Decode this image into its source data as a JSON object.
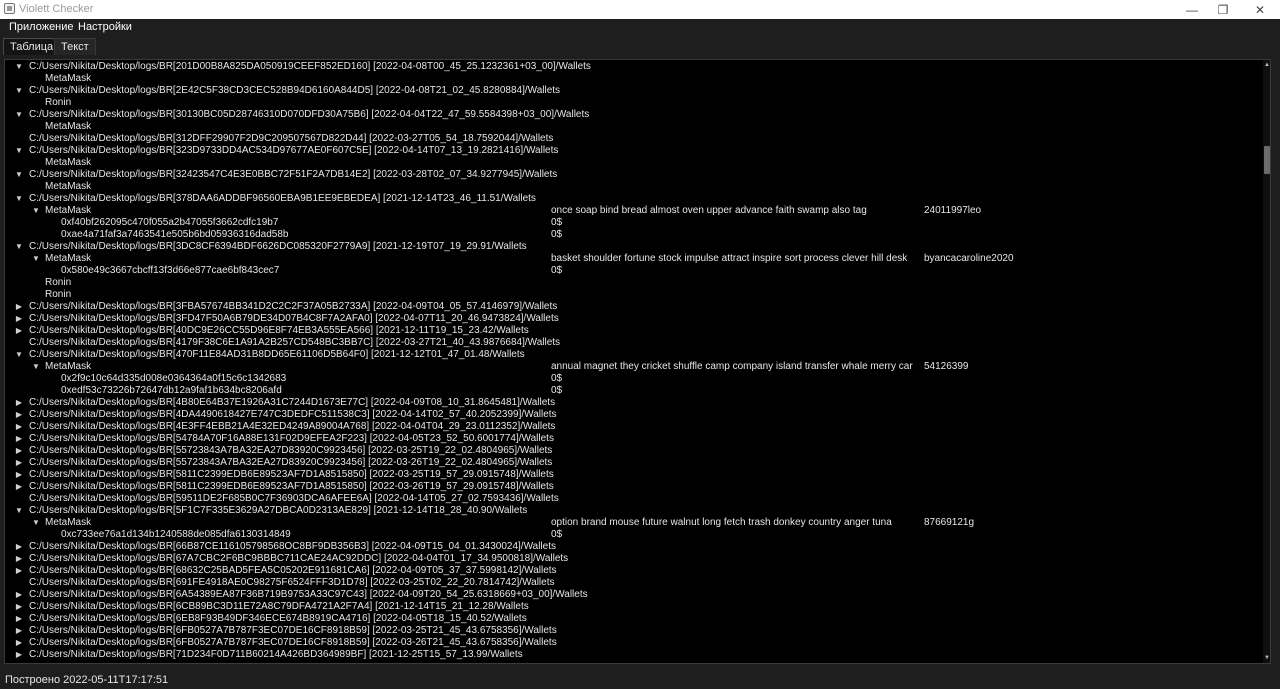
{
  "window": {
    "title": "Violett Checker",
    "min_glyph": "—",
    "restore_glyph": "❐",
    "close_glyph": "✕"
  },
  "menu": {
    "items": [
      "Приложение",
      "Настройки"
    ]
  },
  "tabs": [
    {
      "label": "Таблица",
      "active": true
    },
    {
      "label": "Текст",
      "active": false
    }
  ],
  "status": "Построено 2022-05-11T17:17:51",
  "tree": [
    {
      "level": 0,
      "toggle": "expanded",
      "cols": [
        "C:/Users/Nikita/Desktop/logs/BR[201D00B8A825DA050919CEEF852ED160] [2022-04-08T00_45_25.1232361+03_00]/Wallets"
      ]
    },
    {
      "level": 1,
      "toggle": "none",
      "cols": [
        "MetaMask"
      ]
    },
    {
      "level": 0,
      "toggle": "expanded",
      "cols": [
        "C:/Users/Nikita/Desktop/logs/BR[2E42C5F38CD3CEC528B94D6160A844D5] [2022-04-08T21_02_45.8280884]/Wallets"
      ]
    },
    {
      "level": 1,
      "toggle": "none",
      "cols": [
        "Ronin"
      ]
    },
    {
      "level": 0,
      "toggle": "expanded",
      "cols": [
        "C:/Users/Nikita/Desktop/logs/BR[30130BC05D28746310D070DFD30A75B6] [2022-04-04T22_47_59.5584398+03_00]/Wallets"
      ]
    },
    {
      "level": 1,
      "toggle": "none",
      "cols": [
        "MetaMask"
      ]
    },
    {
      "level": 0,
      "toggle": "none",
      "cols": [
        "C:/Users/Nikita/Desktop/logs/BR[312DFF29907F2D9C209507567D822D44] [2022-03-27T05_54_18.7592044]/Wallets"
      ]
    },
    {
      "level": 0,
      "toggle": "expanded",
      "cols": [
        "C:/Users/Nikita/Desktop/logs/BR[323D9733DD4AC534D97677AE0F607C5E] [2022-04-14T07_13_19.2821416]/Wallets"
      ]
    },
    {
      "level": 1,
      "toggle": "none",
      "cols": [
        "MetaMask"
      ]
    },
    {
      "level": 0,
      "toggle": "expanded",
      "cols": [
        "C:/Users/Nikita/Desktop/logs/BR[32423547C4E3E0BBC72F51F2A7DB14E2] [2022-03-28T02_07_34.9277945]/Wallets"
      ]
    },
    {
      "level": 1,
      "toggle": "none",
      "cols": [
        "MetaMask"
      ]
    },
    {
      "level": 0,
      "toggle": "expanded",
      "cols": [
        "C:/Users/Nikita/Desktop/logs/BR[378DAA6ADDBF96560EBA9B1EE9EBEDEA] [2021-12-14T23_46_11.51/Wallets"
      ]
    },
    {
      "level": 1,
      "toggle": "expanded",
      "cols": [
        "MetaMask",
        "once soap bind bread almost oven upper advance faith swamp also tag",
        "24011997leo"
      ]
    },
    {
      "level": 2,
      "toggle": "none",
      "cols": [
        "0xf40bf262095c470f055a2b47055f3662cdfc19b7",
        "0$"
      ]
    },
    {
      "level": 2,
      "toggle": "none",
      "cols": [
        "0xae4a71faf3a7463541e505b6bd05936316dad58b",
        "0$"
      ]
    },
    {
      "level": 0,
      "toggle": "expanded",
      "cols": [
        "C:/Users/Nikita/Desktop/logs/BR[3DC8CF6394BDF6626DC085320F2779A9] [2021-12-19T07_19_29.91/Wallets"
      ]
    },
    {
      "level": 1,
      "toggle": "expanded",
      "cols": [
        "MetaMask",
        "basket shoulder fortune stock impulse attract inspire sort process clever hill desk",
        "byancacaroline2020"
      ]
    },
    {
      "level": 2,
      "toggle": "none",
      "cols": [
        "0x580e49c3667cbcff13f3d66e877cae6bf843cec7",
        "0$"
      ]
    },
    {
      "level": 1,
      "toggle": "none",
      "cols": [
        "Ronin"
      ]
    },
    {
      "level": 1,
      "toggle": "none",
      "cols": [
        "Ronin"
      ]
    },
    {
      "level": 0,
      "toggle": "collapsed",
      "cols": [
        "C:/Users/Nikita/Desktop/logs/BR[3FBA57674BB341D2C2C2F37A05B2733A] [2022-04-09T04_05_57.4146979]/Wallets"
      ]
    },
    {
      "level": 0,
      "toggle": "collapsed",
      "cols": [
        "C:/Users/Nikita/Desktop/logs/BR[3FD47F50A6B79DE34D07B4C8F7A2AFA0] [2022-04-07T11_20_46.9473824]/Wallets"
      ]
    },
    {
      "level": 0,
      "toggle": "collapsed",
      "cols": [
        "C:/Users/Nikita/Desktop/logs/BR[40DC9E26CC55D96E8F74EB3A555EA566] [2021-12-11T19_15_23.42/Wallets"
      ]
    },
    {
      "level": 0,
      "toggle": "none",
      "cols": [
        "C:/Users/Nikita/Desktop/logs/BR[4179F38C6E1A91A2B257CD548BC3BB7C] [2022-03-27T21_40_43.9876684]/Wallets"
      ]
    },
    {
      "level": 0,
      "toggle": "expanded",
      "cols": [
        "C:/Users/Nikita/Desktop/logs/BR[470F11E84AD31B8DD65E61106D5B64F0] [2021-12-12T01_47_01.48/Wallets"
      ]
    },
    {
      "level": 1,
      "toggle": "expanded",
      "cols": [
        "MetaMask",
        "annual magnet they cricket shuffle camp company island transfer whale merry car",
        "54126399"
      ]
    },
    {
      "level": 2,
      "toggle": "none",
      "cols": [
        "0x2f9c10c64d335d008e0364364a0f15c6c1342683",
        "0$"
      ]
    },
    {
      "level": 2,
      "toggle": "none",
      "cols": [
        "0xedf53c73226b72647db12a9faf1b634bc8206afd",
        "0$"
      ]
    },
    {
      "level": 0,
      "toggle": "collapsed",
      "cols": [
        "C:/Users/Nikita/Desktop/logs/BR[4B80E64B37E1926A31C7244D1673E77C] [2022-04-09T08_10_31.8645481]/Wallets"
      ]
    },
    {
      "level": 0,
      "toggle": "collapsed",
      "cols": [
        "C:/Users/Nikita/Desktop/logs/BR[4DA4490618427E747C3DEDFC511538C3] [2022-04-14T02_57_40.2052399]/Wallets"
      ]
    },
    {
      "level": 0,
      "toggle": "collapsed",
      "cols": [
        "C:/Users/Nikita/Desktop/logs/BR[4E3FF4EBB21A4E32ED4249A89004A768] [2022-04-04T04_29_23.0112352]/Wallets"
      ]
    },
    {
      "level": 0,
      "toggle": "collapsed",
      "cols": [
        "C:/Users/Nikita/Desktop/logs/BR[54784A70F16A88E131F02D9EFEA2F223] [2022-04-05T23_52_50.6001774]/Wallets"
      ]
    },
    {
      "level": 0,
      "toggle": "collapsed",
      "cols": [
        "C:/Users/Nikita/Desktop/logs/BR[55723843A7BA32EA27D83920C9923456] [2022-03-25T19_22_02.4804965]/Wallets"
      ]
    },
    {
      "level": 0,
      "toggle": "collapsed",
      "cols": [
        "C:/Users/Nikita/Desktop/logs/BR[55723843A7BA32EA27D83920C9923456] [2022-03-26T19_22_02.4804965]/Wallets"
      ]
    },
    {
      "level": 0,
      "toggle": "collapsed",
      "cols": [
        "C:/Users/Nikita/Desktop/logs/BR[5811C2399EDB6E89523AF7D1A8515850] [2022-03-25T19_57_29.0915748]/Wallets"
      ]
    },
    {
      "level": 0,
      "toggle": "collapsed",
      "cols": [
        "C:/Users/Nikita/Desktop/logs/BR[5811C2399EDB6E89523AF7D1A8515850] [2022-03-26T19_57_29.0915748]/Wallets"
      ]
    },
    {
      "level": 0,
      "toggle": "none",
      "cols": [
        "C:/Users/Nikita/Desktop/logs/BR[59511DE2F685B0C7F36903DCA6AFEE6A] [2022-04-14T05_27_02.7593436]/Wallets"
      ]
    },
    {
      "level": 0,
      "toggle": "expanded",
      "cols": [
        "C:/Users/Nikita/Desktop/logs/BR[5F1C7F335E3629A27DBCA0D2313AE829] [2021-12-14T18_28_40.90/Wallets"
      ]
    },
    {
      "level": 1,
      "toggle": "expanded",
      "cols": [
        "MetaMask",
        "option brand mouse future walnut long fetch trash donkey country anger tuna",
        "87669121g"
      ]
    },
    {
      "level": 2,
      "toggle": "none",
      "cols": [
        "0xc733ee76a1d134b1240588de085dfa6130314849",
        "0$"
      ]
    },
    {
      "level": 0,
      "toggle": "collapsed",
      "cols": [
        "C:/Users/Nikita/Desktop/logs/BR[66B87CE116105798568OC8BF9DB356B3] [2022-04-09T15_04_01.3430024]/Wallets"
      ]
    },
    {
      "level": 0,
      "toggle": "collapsed",
      "cols": [
        "C:/Users/Nikita/Desktop/logs/BR[67A7CBC2F6BC9BBBC711CAE24AC92DDC] [2022-04-04T01_17_34.9500818]/Wallets"
      ]
    },
    {
      "level": 0,
      "toggle": "collapsed",
      "cols": [
        "C:/Users/Nikita/Desktop/logs/BR[68632C25BAD5FEA5C05202E911681CA6] [2022-04-09T05_37_37.5998142]/Wallets"
      ]
    },
    {
      "level": 0,
      "toggle": "none",
      "cols": [
        "C:/Users/Nikita/Desktop/logs/BR[691FE4918AE0C98275F6524FFF3D1D78] [2022-03-25T02_22_20.7814742]/Wallets"
      ]
    },
    {
      "level": 0,
      "toggle": "collapsed",
      "cols": [
        "C:/Users/Nikita/Desktop/logs/BR[6A54389EA87F36B719B9753A33C97C43] [2022-04-09T20_54_25.6318669+03_00]/Wallets"
      ]
    },
    {
      "level": 0,
      "toggle": "collapsed",
      "cols": [
        "C:/Users/Nikita/Desktop/logs/BR[6CB89BC3D11E72A8C79DFA4721A2F7A4] [2021-12-14T15_21_12.28/Wallets"
      ]
    },
    {
      "level": 0,
      "toggle": "collapsed",
      "cols": [
        "C:/Users/Nikita/Desktop/logs/BR[6EB8F93B49DF346ECE674B8919CA4716] [2022-04-05T18_15_40.52/Wallets"
      ]
    },
    {
      "level": 0,
      "toggle": "collapsed",
      "cols": [
        "C:/Users/Nikita/Desktop/logs/BR[6FB0527A7B787F3EC07DE16CF8918B59] [2022-03-25T21_45_43.6758356]/Wallets"
      ]
    },
    {
      "level": 0,
      "toggle": "collapsed",
      "cols": [
        "C:/Users/Nikita/Desktop/logs/BR[6FB0527A7B787F3EC07DE16CF8918B59] [2022-03-26T21_45_43.6758356]/Wallets"
      ]
    },
    {
      "level": 0,
      "toggle": "collapsed",
      "cols": [
        "C:/Users/Nikita/Desktop/logs/BR[71D234F0D711B60214A426BD364989BF] [2021-12-25T15_57_13.99/Wallets"
      ]
    }
  ]
}
